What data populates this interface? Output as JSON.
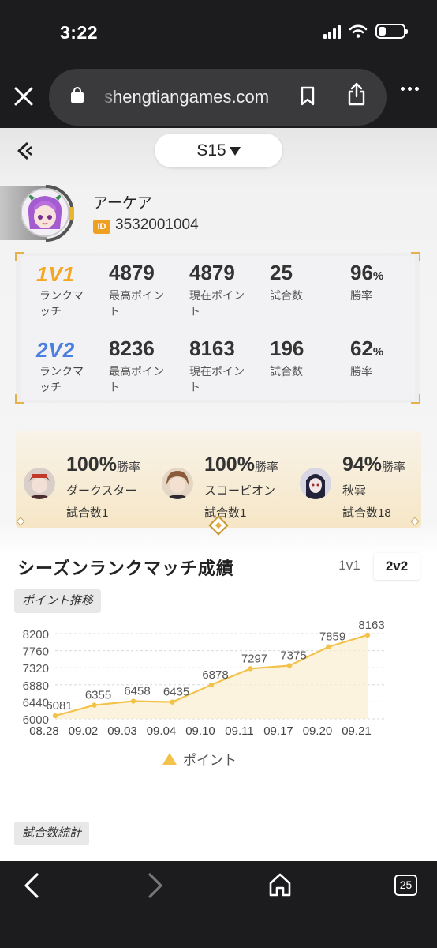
{
  "status_bar": {
    "time": "3:22",
    "battery_level": 0.3
  },
  "browser": {
    "url": "shengtiangames.com",
    "tab_count": "25"
  },
  "header": {
    "season": "S15"
  },
  "player": {
    "name": "アーケア",
    "id_badge": "ID",
    "id": "3532001004"
  },
  "modes": [
    {
      "badge": "1V1",
      "badge_color": "#f5a623",
      "sub": "ランクマッチ",
      "max_points": "4879",
      "max_points_label": "最高ポイント",
      "current_points": "4879",
      "current_points_label": "現在ポイント",
      "games": "25",
      "games_label": "試合数",
      "winrate": "96",
      "winrate_unit": "%",
      "winrate_label": "勝率"
    },
    {
      "badge": "2V2",
      "badge_color": "#4a7ee0",
      "sub": "ランクマッチ",
      "max_points": "8236",
      "max_points_label": "最高ポイント",
      "current_points": "8163",
      "current_points_label": "現在ポイント",
      "games": "196",
      "games_label": "試合数",
      "winrate": "62",
      "winrate_unit": "%",
      "winrate_label": "勝率"
    }
  ],
  "heroes": [
    {
      "winrate": "100%",
      "winrate_label": "勝率",
      "name": "ダークスター",
      "games": "試合数1"
    },
    {
      "winrate": "100%",
      "winrate_label": "勝率",
      "name": "スコーピオン",
      "games": "試合数1"
    },
    {
      "winrate": "94%",
      "winrate_label": "勝率",
      "name": "秋雲",
      "games": "試合数18"
    }
  ],
  "section": {
    "title": "シーズンランクマッチ成績",
    "tabs": [
      "1v1",
      "2v2"
    ],
    "active_tab": "2v2",
    "points_chip": "ポイント推移",
    "games_chip": "試合数統計"
  },
  "chart_data": {
    "type": "line",
    "categories": [
      "08.28",
      "09.02",
      "09.03",
      "09.04",
      "09.10",
      "09.11",
      "09.17",
      "09.20",
      "09.21"
    ],
    "series": [
      {
        "name": "ポイント",
        "values": [
          6081,
          6355,
          6458,
          6435,
          6878,
          7297,
          7375,
          7859,
          8163
        ]
      }
    ],
    "ylim": [
      6000,
      8200
    ],
    "yticks": [
      "8200",
      "7760",
      "7320",
      "6880",
      "6440",
      "6000"
    ],
    "color": "#f3c24a",
    "grid": true,
    "legend": "bottom"
  }
}
